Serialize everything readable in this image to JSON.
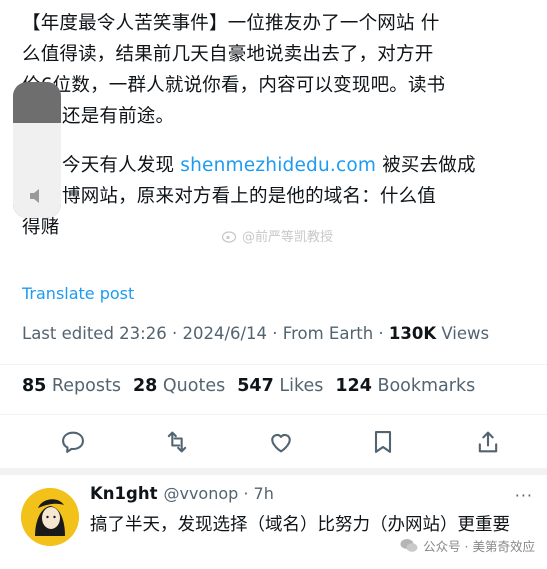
{
  "post": {
    "line1": "【年度最令人苦笑事件】一位推友办了一个网站 什",
    "line2": "么值得读，结果前几天自豪地说卖出去了，对方开",
    "line3": "价6位数，一群人就说你看，内容可以变现吧。读书",
    "line4": "还是有前途。",
    "line5_pre": "今天有人发现 ",
    "line5_link": "shenmezhidedu.com",
    "line5_post": " 被买去做成",
    "line6": "博网站，原来对方看上的是他的域名：什么值",
    "line7": "得赌"
  },
  "watermark_mid": "@前严等凯教授",
  "translate_label": "Translate post",
  "meta": {
    "edited": "Last edited 23:26 · 2024/6/14 · From Earth · ",
    "views_count": "130K",
    "views_label": " Views"
  },
  "stats": {
    "reposts_count": "85",
    "reposts_label": " Reposts",
    "quotes_count": "28",
    "quotes_label": " Quotes",
    "likes_count": "547",
    "likes_label": " Likes",
    "bookmarks_count": "124",
    "bookmarks_label": " Bookmarks"
  },
  "actions": [
    "reply-icon",
    "repost-icon",
    "like-icon",
    "bookmark-icon",
    "share-icon"
  ],
  "reply": {
    "name": "Kn1ght",
    "handle": "@vvonop · 7h",
    "more": "···",
    "text": "搞了半天，发现选择（域名）比努力（办网站）更重要"
  },
  "wechat_watermark": "公众号 · 美第奇效应",
  "colors": {
    "accent": "#1d9bf0",
    "muted": "#536471",
    "text": "#0f1419"
  }
}
